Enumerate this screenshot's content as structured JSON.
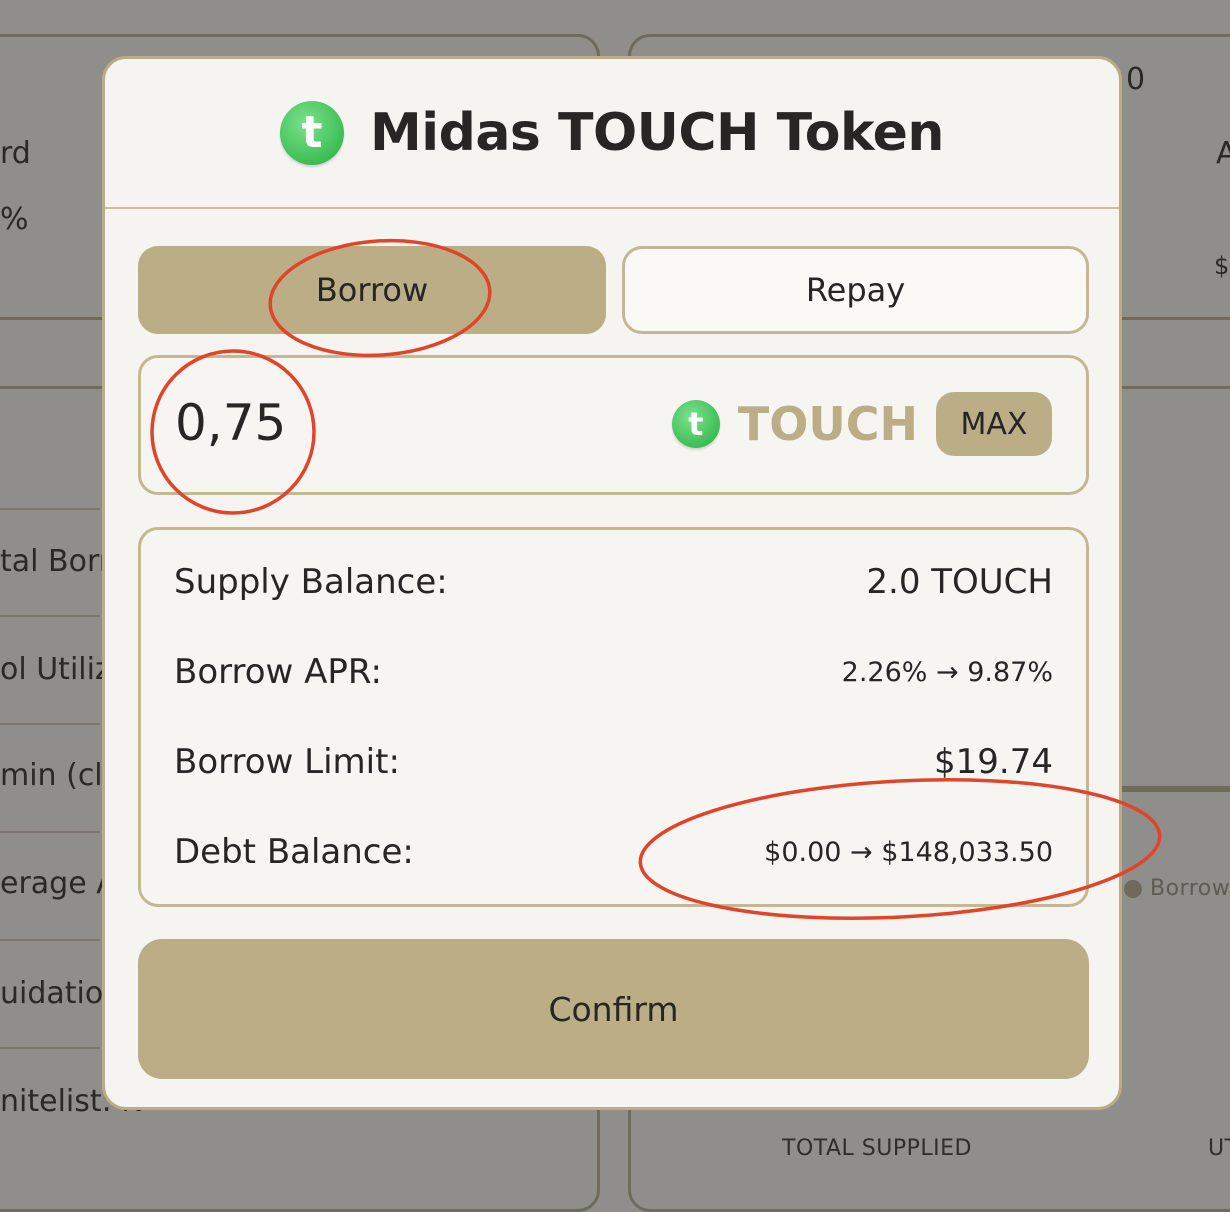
{
  "background": {
    "left_fragments": [
      "rd",
      "%",
      "tal Borro",
      "ol Utiliza",
      "min (cl",
      "erage A",
      "uidatio",
      "nitelist: N"
    ],
    "right_fragments": [
      "0",
      "A",
      "$",
      "Borrow"
    ],
    "bottom_labels": [
      "TOTAL SUPPLIED",
      "UT"
    ]
  },
  "modal": {
    "icon": "touch-token-icon",
    "icon_glyph": "t",
    "title": "Midas TOUCH Token",
    "tabs": {
      "borrow": "Borrow",
      "repay": "Repay",
      "active": "borrow"
    },
    "amount": {
      "value": "0,75",
      "symbol": "TOUCH",
      "max_label": "MAX"
    },
    "stats": [
      {
        "label": "Supply Balance:",
        "value": "2.0 TOUCH"
      },
      {
        "label": "Borrow APR:",
        "value": "2.26% → 9.87%"
      },
      {
        "label": "Borrow Limit:",
        "value": "$19.74"
      },
      {
        "label": "Debt Balance:",
        "value": "$0.00 → $148,033.50"
      }
    ],
    "confirm_label": "Confirm"
  },
  "colors": {
    "accent": "#bbad86",
    "border": "#c4b894",
    "modal_bg": "#f6f4f0",
    "annotation": "#e0452a",
    "token_green": "#3cbf55"
  }
}
